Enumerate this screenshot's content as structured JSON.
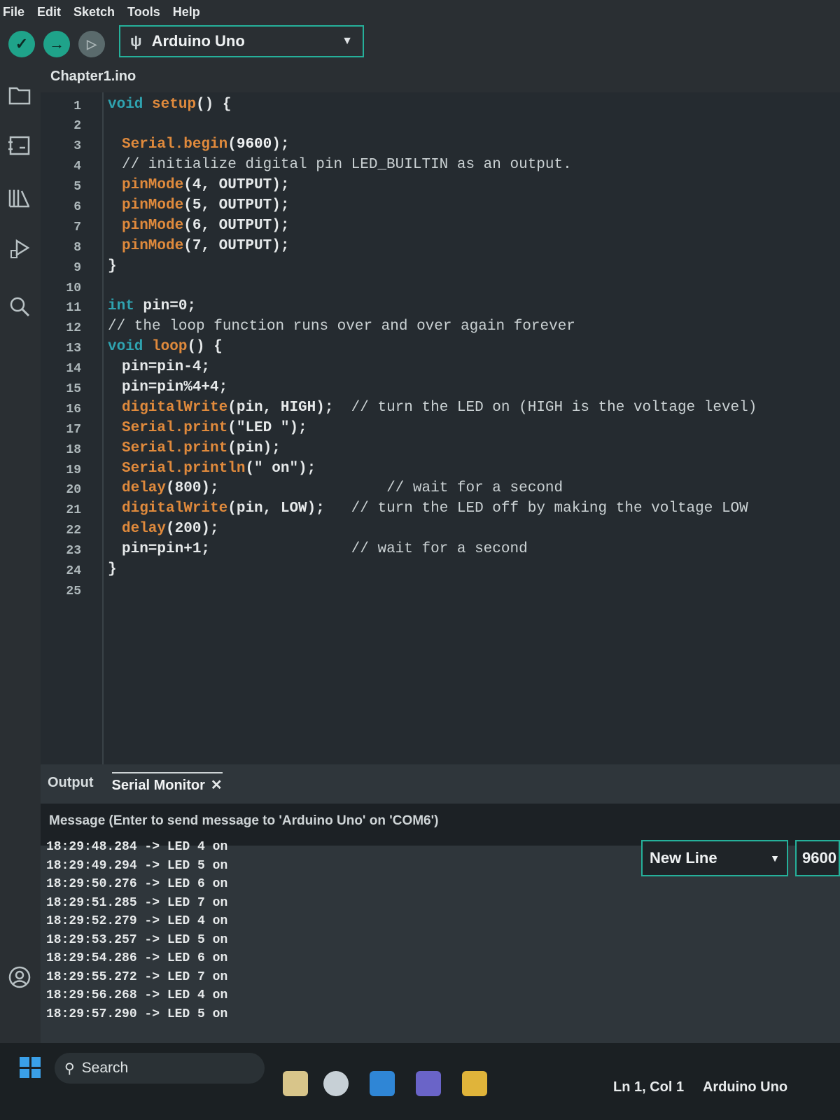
{
  "menu": [
    "File",
    "Edit",
    "Sketch",
    "Tools",
    "Help"
  ],
  "toolbar": {
    "verify": "✓",
    "upload": "→",
    "debug": "▷",
    "board": "Arduino Uno"
  },
  "tab": {
    "filename": "Chapter1.ino"
  },
  "editor": {
    "line_numbers": [
      "1",
      "2",
      "3",
      "4",
      "5",
      "6",
      "7",
      "8",
      "9",
      "10",
      "11",
      "12",
      "13",
      "14",
      "15",
      "16",
      "17",
      "18",
      "19",
      "20",
      "21",
      "22",
      "23",
      "24",
      "25"
    ]
  },
  "output": {
    "tab_output": "Output",
    "tab_serial": "Serial Monitor",
    "message_placeholder": "Message (Enter to send message to 'Arduino Uno' on 'COM6')",
    "line_ending": "New Line",
    "baud": "9600",
    "lines": [
      "18:29:48.284 -> LED 4 on",
      "18:29:49.294 -> LED 5 on",
      "18:29:50.276 -> LED 6 on",
      "18:29:51.285 -> LED 7 on",
      "18:29:52.279 -> LED 4 on",
      "18:29:53.257 -> LED 5 on",
      "18:29:54.286 -> LED 6 on",
      "18:29:55.272 -> LED 7 on",
      "18:29:56.268 -> LED 4 on",
      "18:29:57.290 -> LED 5 on"
    ]
  },
  "taskbar": {
    "search": "Search",
    "cursor": "Ln 1, Col 1",
    "board_status": "Arduino Uno"
  },
  "colors": {
    "accent": "#1fa38a",
    "border": "#25b09a",
    "keyword": "#2fa3b0",
    "function": "#e08a3c"
  }
}
